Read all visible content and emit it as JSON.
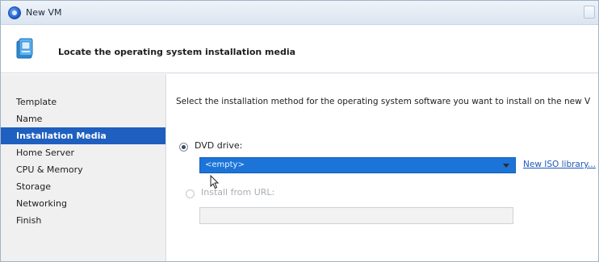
{
  "window": {
    "title": "New VM"
  },
  "header": {
    "title": "Locate the operating system installation media"
  },
  "sidebar": {
    "items": [
      {
        "label": "Template",
        "active": false
      },
      {
        "label": "Name",
        "active": false
      },
      {
        "label": "Installation Media",
        "active": true
      },
      {
        "label": "Home Server",
        "active": false
      },
      {
        "label": "CPU & Memory",
        "active": false
      },
      {
        "label": "Storage",
        "active": false
      },
      {
        "label": "Networking",
        "active": false
      },
      {
        "label": "Finish",
        "active": false
      }
    ]
  },
  "main": {
    "instruction": "Select the installation method for the operating system software you want to install on the new V",
    "dvd_option": {
      "label": "DVD drive:",
      "selected": true
    },
    "dvd_dropdown": {
      "value": "<empty>"
    },
    "iso_link": "New ISO library...",
    "url_option": {
      "label": "Install from URL:",
      "selected": false,
      "enabled": false
    },
    "url_field": {
      "value": ""
    }
  },
  "colors": {
    "accent": "#1f5fbf",
    "dropdown_selected": "#1c74d8",
    "link": "#1f57b8",
    "sidebar_bg": "#f0f0f0"
  },
  "icons": {
    "app": "xen-vm-icon",
    "header": "installation-media-icon"
  }
}
